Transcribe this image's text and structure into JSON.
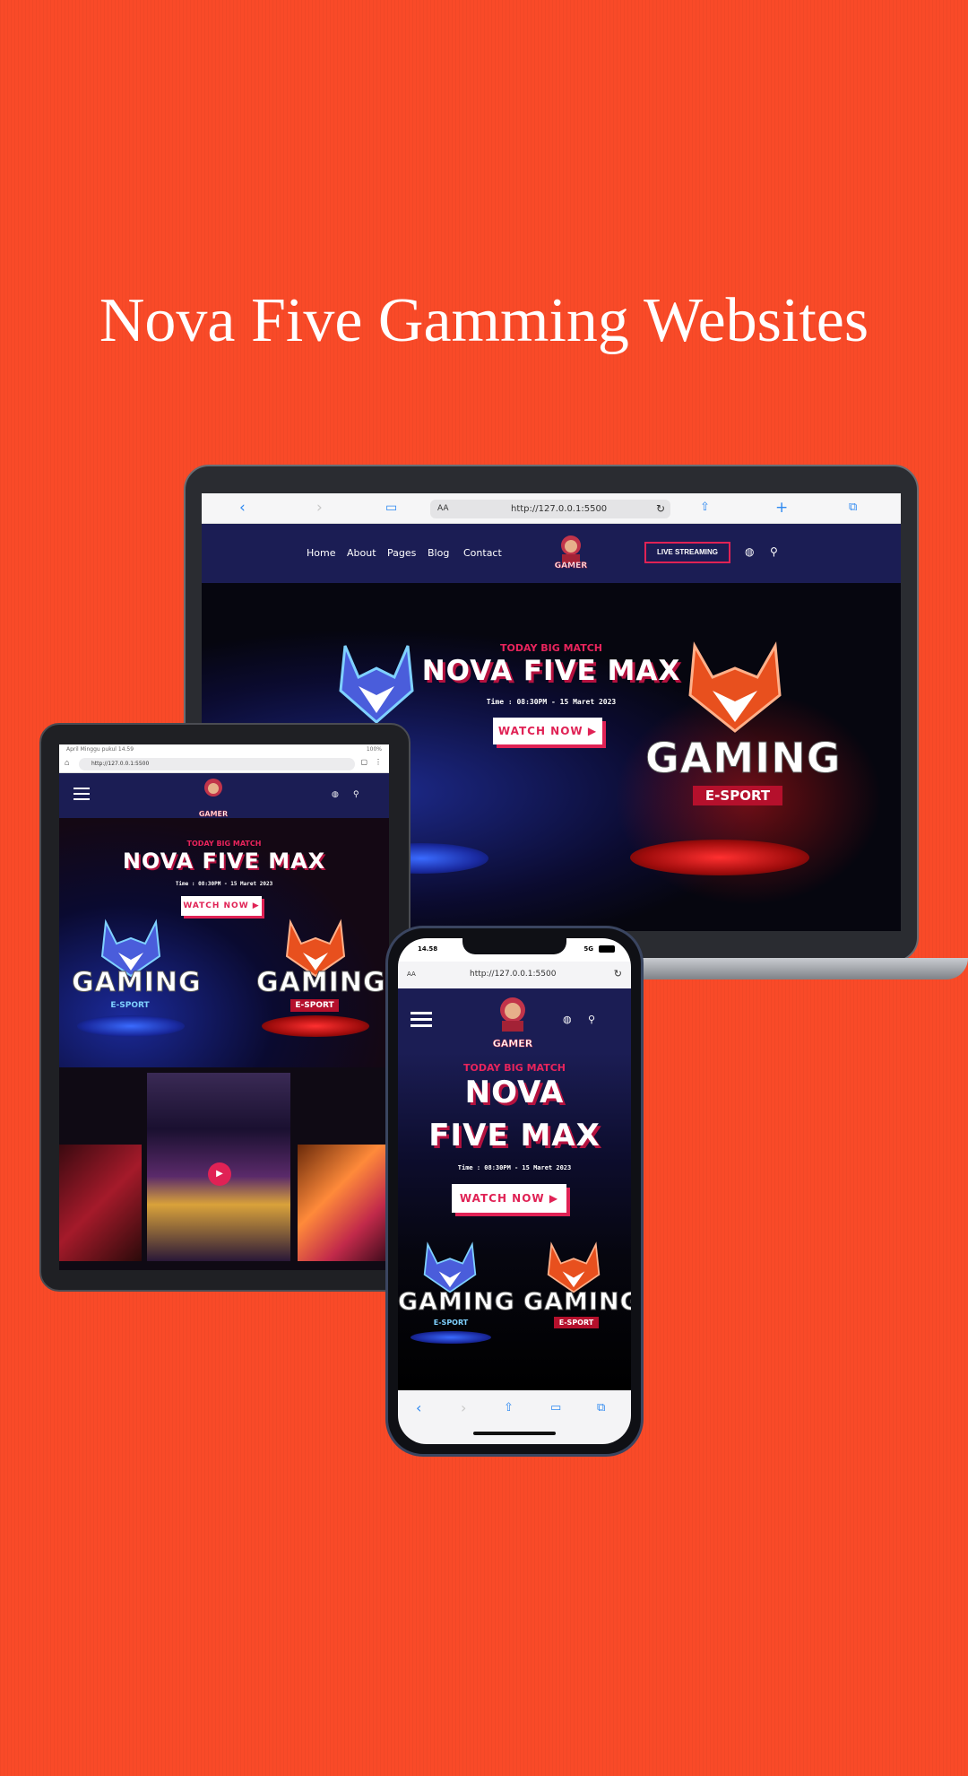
{
  "headline": "Nova Five Gamming Websites",
  "browser": {
    "url": "http://127.0.0.1:5500",
    "aa_label": "AA"
  },
  "nav": {
    "links": [
      "Home",
      "About",
      "Pages",
      "Blog",
      "Contact"
    ],
    "live_button": "LIVE STREAMING",
    "logo_text": "GAMER"
  },
  "hero": {
    "subtitle": "TODAY BIG MATCH",
    "title": "NOVA FIVE MAX",
    "title_line1": "NOVA",
    "title_line2": "FIVE MAX",
    "time": "Time : 08:30PM - 15 Maret 2023",
    "watch_button": "WATCH NOW",
    "badge_word": "GAMING",
    "badge_sub": "E-SPORT"
  },
  "tablet": {
    "status_left": "April Minggu pukul 14.59",
    "status_right": "100%"
  },
  "phone": {
    "time": "14.58",
    "network": "5G"
  },
  "colors": {
    "background": "#f94a28",
    "nav": "#1b1d54",
    "accent": "#e02255"
  }
}
